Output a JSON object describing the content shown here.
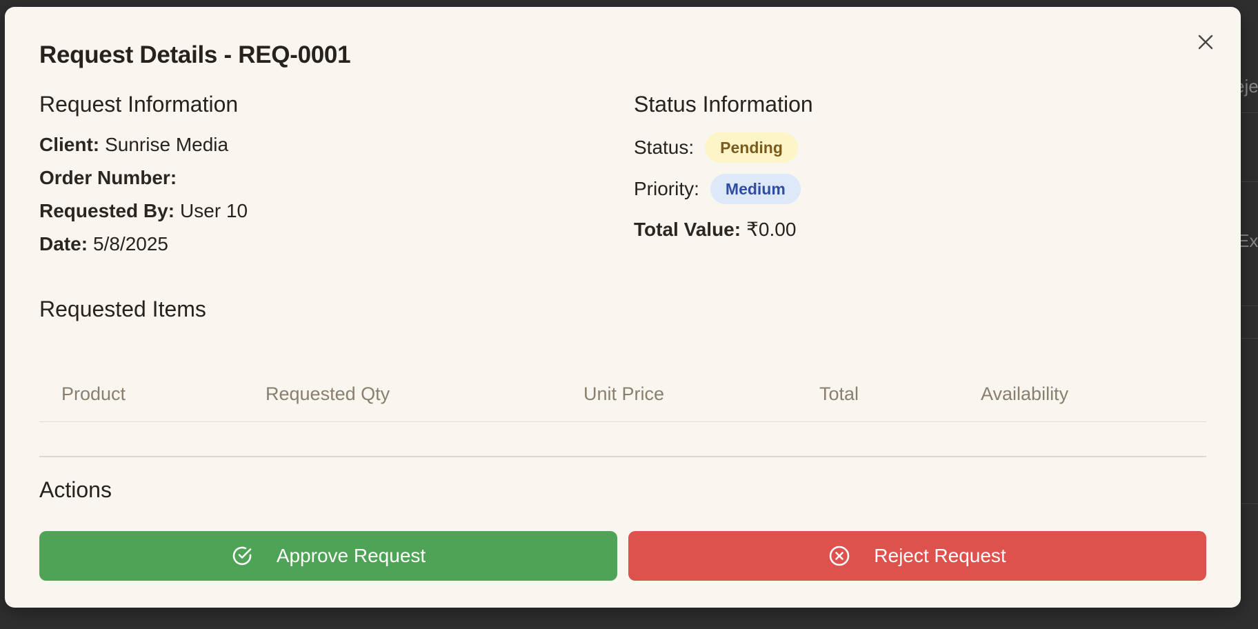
{
  "modal": {
    "title": "Request Details - REQ-0001"
  },
  "request_info": {
    "heading": "Request Information",
    "client_label": "Client:",
    "client_value": "Sunrise Media",
    "order_label": "Order Number:",
    "order_value": "",
    "requested_by_label": "Requested By:",
    "requested_by_value": "User 10",
    "date_label": "Date:",
    "date_value": "5/8/2025"
  },
  "status_info": {
    "heading": "Status Information",
    "status_label": "Status:",
    "status_value": "Pending",
    "priority_label": "Priority:",
    "priority_value": "Medium",
    "total_label": "Total Value:",
    "total_value": "₹0.00"
  },
  "items": {
    "heading": "Requested Items",
    "columns": [
      "Product",
      "Requested Qty",
      "Unit Price",
      "Total",
      "Availability"
    ],
    "rows": []
  },
  "actions": {
    "heading": "Actions",
    "approve_label": "Approve Request",
    "reject_label": "Reject Request"
  },
  "background": {
    "frag_1": "eje",
    "frag_2": "Ex"
  },
  "colors": {
    "approve": "#4fa356",
    "reject": "#de524e",
    "pending_badge_bg": "#fdf5c7",
    "medium_badge_bg": "#dde8f8"
  },
  "icons": {
    "close": "close-icon",
    "approve": "check-circle-icon",
    "reject": "x-circle-icon"
  }
}
